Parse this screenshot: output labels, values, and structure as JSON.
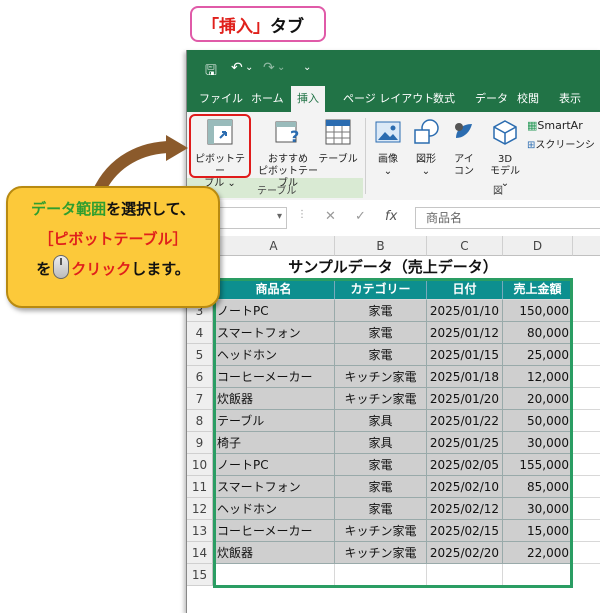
{
  "callout_tab": {
    "bracket_open": "「",
    "tab_name": "挿入",
    "bracket_close": "」",
    "suffix": "タブ"
  },
  "quick_access": {
    "save": "🖫",
    "undo": "↶",
    "redo": "↷",
    "more": "⌄"
  },
  "menu": {
    "items": [
      "ファイル",
      "ホーム",
      "挿入",
      "ページ レイアウト",
      "数式",
      "データ",
      "校閲",
      "表示"
    ],
    "active_index": 2
  },
  "ribbon": {
    "pivot_table_line1": "ピボットテー",
    "pivot_table_line2": "ブル ⌄",
    "recommended_line1": "おすすめ",
    "recommended_line2": "ピボットテーブル",
    "table": "テーブル",
    "table_group_label": "テーブル",
    "image": "画像",
    "image_caret": "⌄",
    "shapes": "図形",
    "shapes_caret": "⌄",
    "icons_line1": "アイ",
    "icons_line2": "コン",
    "model3d_line1": "3D",
    "model3d_line2": "モデル ⌄",
    "smartart": "SmartAr",
    "screenshot": "スクリーンシ",
    "figure_group_label": "図"
  },
  "formula_bar": {
    "name_box": "",
    "cancel": "✕",
    "enter": "✓",
    "fx": "fx",
    "content": "商品名"
  },
  "sheet": {
    "columns": [
      "A",
      "B",
      "C",
      "D"
    ],
    "title": "サンプルデータ（売上データ）",
    "headers": [
      "商品名",
      "カテゴリー",
      "日付",
      "売上金額"
    ],
    "rows": [
      {
        "num": "3",
        "name": "ノートPC",
        "category": "家電",
        "date": "2025/01/10",
        "amount": "150,000"
      },
      {
        "num": "4",
        "name": "スマートフォン",
        "category": "家電",
        "date": "2025/01/12",
        "amount": "80,000"
      },
      {
        "num": "5",
        "name": "ヘッドホン",
        "category": "家電",
        "date": "2025/01/15",
        "amount": "25,000"
      },
      {
        "num": "6",
        "name": "コーヒーメーカー",
        "category": "キッチン家電",
        "date": "2025/01/18",
        "amount": "12,000"
      },
      {
        "num": "7",
        "name": "炊飯器",
        "category": "キッチン家電",
        "date": "2025/01/20",
        "amount": "20,000"
      },
      {
        "num": "8",
        "name": "テーブル",
        "category": "家具",
        "date": "2025/01/22",
        "amount": "50,000"
      },
      {
        "num": "9",
        "name": "椅子",
        "category": "家具",
        "date": "2025/01/25",
        "amount": "30,000"
      },
      {
        "num": "10",
        "name": "ノートPC",
        "category": "家電",
        "date": "2025/02/05",
        "amount": "155,000"
      },
      {
        "num": "11",
        "name": "スマートフォン",
        "category": "家電",
        "date": "2025/02/10",
        "amount": "85,000"
      },
      {
        "num": "12",
        "name": "ヘッドホン",
        "category": "家電",
        "date": "2025/02/12",
        "amount": "30,000"
      },
      {
        "num": "13",
        "name": "コーヒーメーカー",
        "category": "キッチン家電",
        "date": "2025/02/15",
        "amount": "15,000"
      },
      {
        "num": "14",
        "name": "炊飯器",
        "category": "キッチン家電",
        "date": "2025/02/20",
        "amount": "22,000"
      }
    ],
    "last_row_num": "15"
  },
  "callout": {
    "line1_green": "データ範囲",
    "line1_rest": "を選択して、",
    "line2": "［ピボットテーブル］",
    "line3_pre": "を",
    "line3_red": "クリック",
    "line3_post": "します。"
  },
  "colors": {
    "excel_green": "#217346",
    "header_teal": "#0d8f8f",
    "callout_yellow": "#fcc93a",
    "highlight_red": "#e01b1b"
  }
}
